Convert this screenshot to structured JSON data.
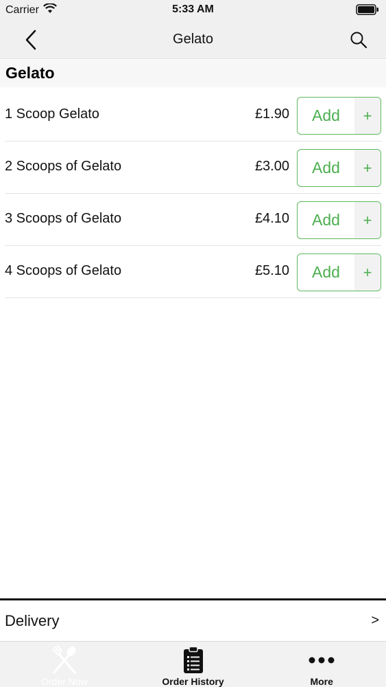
{
  "status_bar": {
    "carrier": "Carrier",
    "time": "5:33 AM"
  },
  "nav": {
    "title": "Gelato"
  },
  "section": {
    "title": "Gelato"
  },
  "items": [
    {
      "name": "1 Scoop Gelato",
      "price": "£1.90",
      "add_label": "Add",
      "plus": "+"
    },
    {
      "name": "2 Scoops of Gelato",
      "price": "£3.00",
      "add_label": "Add",
      "plus": "+"
    },
    {
      "name": "3 Scoops of Gelato",
      "price": "£4.10",
      "add_label": "Add",
      "plus": "+"
    },
    {
      "name": "4 Scoops of Gelato",
      "price": "£5.10",
      "add_label": "Add",
      "plus": "+"
    }
  ],
  "delivery": {
    "label": "Delivery",
    "chevron": ">"
  },
  "tabs": [
    {
      "label": "Order Now",
      "icon": "utensils-icon",
      "active": true
    },
    {
      "label": "Order History",
      "icon": "clipboard-icon",
      "active": false
    },
    {
      "label": "More",
      "icon": "more-dots-icon",
      "active": false
    }
  ],
  "colors": {
    "accent": "#4caf50",
    "bar_background": "#f0f0f0"
  }
}
